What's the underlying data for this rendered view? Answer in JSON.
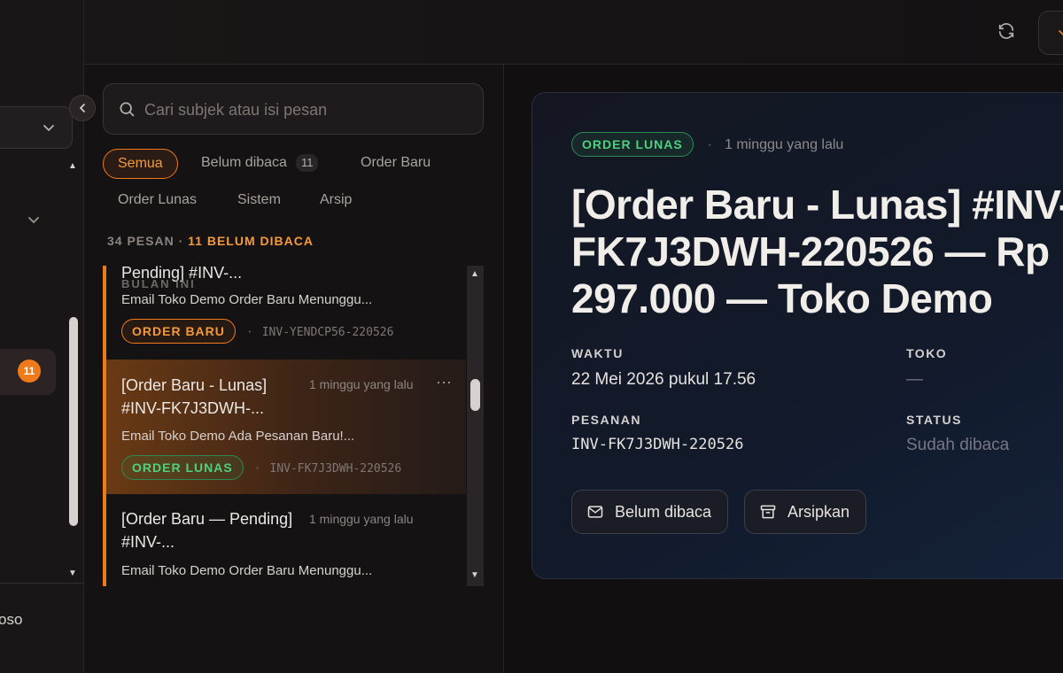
{
  "sidebar": {
    "unread_badge": "11",
    "user_name_fragment": "oso"
  },
  "list": {
    "search_placeholder": "Cari subjek atau isi pesan",
    "filters": [
      {
        "label": "Semua",
        "count": null,
        "active": true
      },
      {
        "label": "Belum dibaca",
        "count": "11",
        "active": false
      },
      {
        "label": "Order Baru",
        "count": null,
        "active": false
      },
      {
        "label": "Order Lunas",
        "count": null,
        "active": false
      },
      {
        "label": "Sistem",
        "count": null,
        "active": false
      },
      {
        "label": "Arsip",
        "count": null,
        "active": false
      }
    ],
    "summary_total": "34 PESAN",
    "summary_sep": "·",
    "summary_unread": "11 BELUM DIBACA",
    "section_label": "BULAN INI",
    "messages": [
      {
        "subject": "Pending] #INV-...",
        "time": "",
        "preview": "Email Toko Demo Order Baru Menunggu...",
        "tag": "ORDER BARU",
        "invoice": "INV-YENDCP56-220526"
      },
      {
        "subject": "[Order Baru - Lunas] #INV-FK7J3DWH-...",
        "time": "1 minggu yang lalu",
        "preview": "Email Toko Demo Ada Pesanan Baru!...",
        "tag": "ORDER LUNAS",
        "invoice": "INV-FK7J3DWH-220526"
      },
      {
        "subject": "[Order Baru — Pending] #INV-...",
        "time": "1 minggu yang lalu",
        "preview": "Email Toko Demo Order Baru Menunggu...",
        "tag": "",
        "invoice": ""
      }
    ],
    "more_glyph": "···",
    "inv_sep": "·"
  },
  "detail": {
    "status_tag": "ORDER LUNAS",
    "dot": "·",
    "ago": "1 minggu yang lalu",
    "title": "[Order Baru - Lunas] #INV-FK7J3DWH-220526 — Rp 297.000 — Toko Demo",
    "waktu_label": "WAKTU",
    "waktu_value": "22 Mei 2026 pukul 17.56",
    "toko_label": "TOKO",
    "toko_value": "—",
    "pesanan_label": "PESANAN",
    "pesanan_value": "INV-FK7J3DWH-220526",
    "status_label": "STATUS",
    "status_value": "Sudah dibaca",
    "btn_unread": "Belum dibaca",
    "btn_archive": "Arsipkan"
  },
  "colors": {
    "accent": "#f07a1a",
    "success": "#4fd07f"
  }
}
